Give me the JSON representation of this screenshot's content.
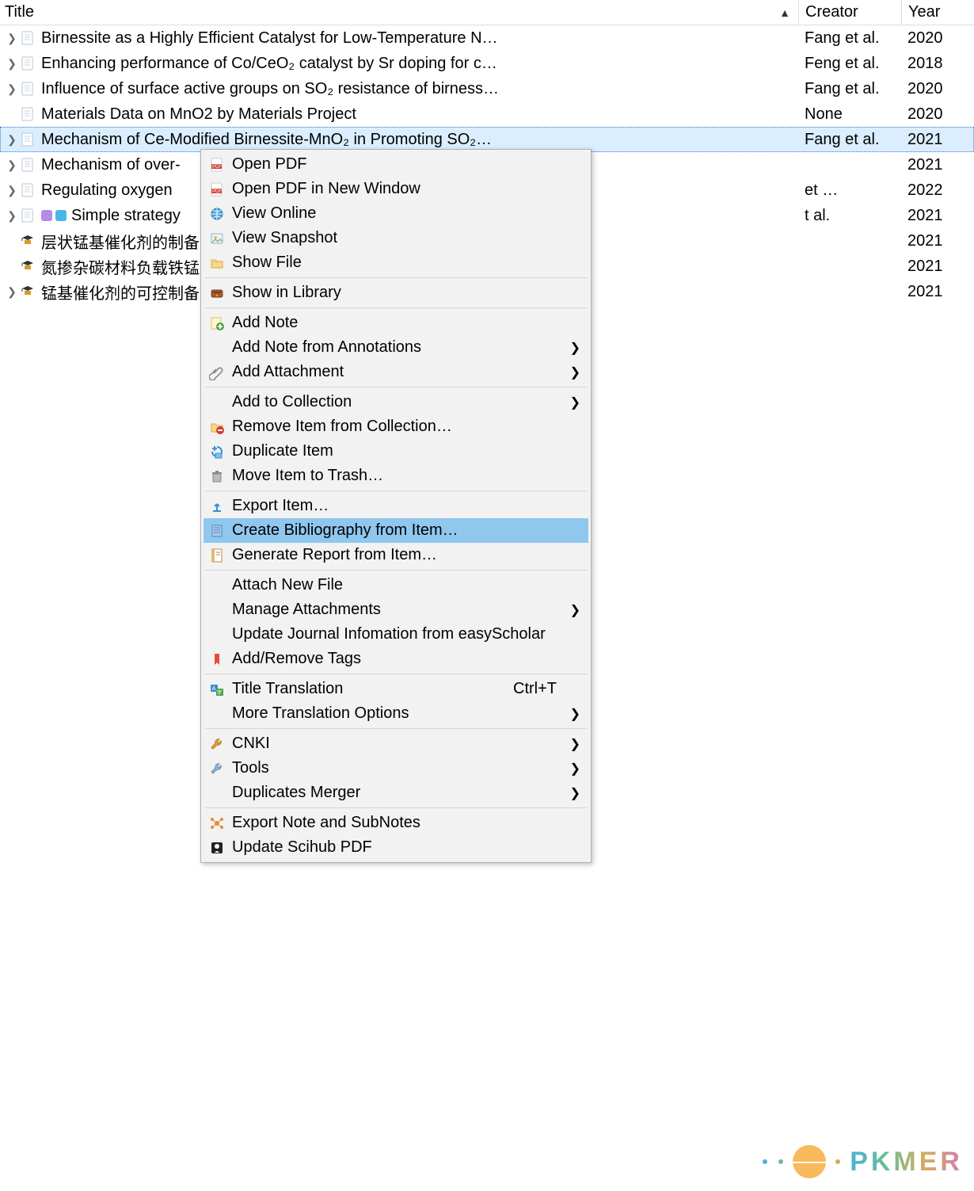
{
  "columns": {
    "title": "Title",
    "creator": "Creator",
    "year": "Year"
  },
  "rows": [
    {
      "expandable": true,
      "icon": "doc",
      "title": "Birnessite as a Highly Efficient Catalyst for Low-Temperature N…",
      "creator": "Fang et al.",
      "year": "2020"
    },
    {
      "expandable": true,
      "icon": "doc",
      "title": "Enhancing performance of Co/CeO₂ catalyst by Sr doping for c…",
      "creator": "Feng et al.",
      "year": "2018"
    },
    {
      "expandable": true,
      "icon": "doc",
      "title": "Influence of surface active groups on SO₂ resistance of birness…",
      "creator": "Fang et al.",
      "year": "2020"
    },
    {
      "expandable": false,
      "icon": "doc",
      "title": "Materials Data on MnO2 by Materials Project",
      "creator": "None",
      "year": "2020"
    },
    {
      "expandable": true,
      "icon": "doc",
      "selected": true,
      "title": "Mechanism of Ce-Modified Birnessite-MnO₂ in Promoting SO₂…",
      "creator": "Fang et al.",
      "year": "2021"
    },
    {
      "expandable": true,
      "icon": "doc",
      "title": "Mechanism of over-",
      "creator": "",
      "year": "2021"
    },
    {
      "expandable": true,
      "icon": "doc",
      "title": "Regulating oxygen",
      "creator": "et …",
      "year": "2022"
    },
    {
      "expandable": true,
      "icon": "doc",
      "tags": [
        "#b48be8",
        "#4ab7e8"
      ],
      "title": "Simple strategy",
      "creator": "t al.",
      "year": "2021"
    },
    {
      "expandable": false,
      "icon": "thesis",
      "title": "层状锰基催化剂的制备",
      "creator": "",
      "year": "2021"
    },
    {
      "expandable": false,
      "icon": "thesis",
      "title": "氮掺杂碳材料负载铁锰",
      "creator": "",
      "year": "2021"
    },
    {
      "expandable": true,
      "icon": "thesis",
      "title": "锰基催化剂的可控制备",
      "creator": "",
      "year": "2021"
    }
  ],
  "menu": [
    {
      "type": "item",
      "icon": "pdf",
      "label": "Open PDF"
    },
    {
      "type": "item",
      "icon": "pdf",
      "label": "Open PDF in New Window"
    },
    {
      "type": "item",
      "icon": "globe",
      "label": "View Online"
    },
    {
      "type": "item",
      "icon": "snap",
      "label": "View Snapshot"
    },
    {
      "type": "item",
      "icon": "folder",
      "label": "Show File"
    },
    {
      "type": "sep"
    },
    {
      "type": "item",
      "icon": "drawer",
      "label": "Show in Library"
    },
    {
      "type": "sep"
    },
    {
      "type": "item",
      "icon": "noteplus",
      "label": "Add Note"
    },
    {
      "type": "item",
      "icon": "",
      "label": "Add Note from Annotations",
      "submenu": true
    },
    {
      "type": "item",
      "icon": "clip",
      "label": "Add Attachment",
      "submenu": true
    },
    {
      "type": "sep"
    },
    {
      "type": "item",
      "icon": "",
      "label": "Add to Collection",
      "submenu": true
    },
    {
      "type": "item",
      "icon": "folderminus",
      "label": "Remove Item from Collection…"
    },
    {
      "type": "item",
      "icon": "dup",
      "label": "Duplicate Item"
    },
    {
      "type": "item",
      "icon": "trash",
      "label": "Move Item to Trash…"
    },
    {
      "type": "sep"
    },
    {
      "type": "item",
      "icon": "export",
      "label": "Export Item…"
    },
    {
      "type": "item",
      "icon": "biblio",
      "label": "Create Bibliography from Item…",
      "highlight": true
    },
    {
      "type": "item",
      "icon": "report",
      "label": "Generate Report from Item…"
    },
    {
      "type": "sep"
    },
    {
      "type": "item",
      "icon": "",
      "label": "Attach New File"
    },
    {
      "type": "item",
      "icon": "",
      "label": "Manage Attachments",
      "submenu": true
    },
    {
      "type": "item",
      "icon": "",
      "label": "Update Journal Infomation from easyScholar"
    },
    {
      "type": "item",
      "icon": "bookmark",
      "label": "Add/Remove Tags"
    },
    {
      "type": "sep"
    },
    {
      "type": "item",
      "icon": "translate",
      "label": "Title Translation",
      "shortcut": "Ctrl+T"
    },
    {
      "type": "item",
      "icon": "",
      "label": "More Translation Options",
      "submenu": true
    },
    {
      "type": "sep"
    },
    {
      "type": "item",
      "icon": "wrench",
      "label": "CNKI",
      "submenu": true
    },
    {
      "type": "item",
      "icon": "wrench2",
      "label": "Tools",
      "submenu": true
    },
    {
      "type": "item",
      "icon": "",
      "label": "Duplicates Merger",
      "submenu": true
    },
    {
      "type": "sep"
    },
    {
      "type": "item",
      "icon": "network",
      "label": "Export Note and SubNotes"
    },
    {
      "type": "item",
      "icon": "scihub",
      "label": "Update Scihub PDF"
    }
  ],
  "watermark": "PKMER"
}
